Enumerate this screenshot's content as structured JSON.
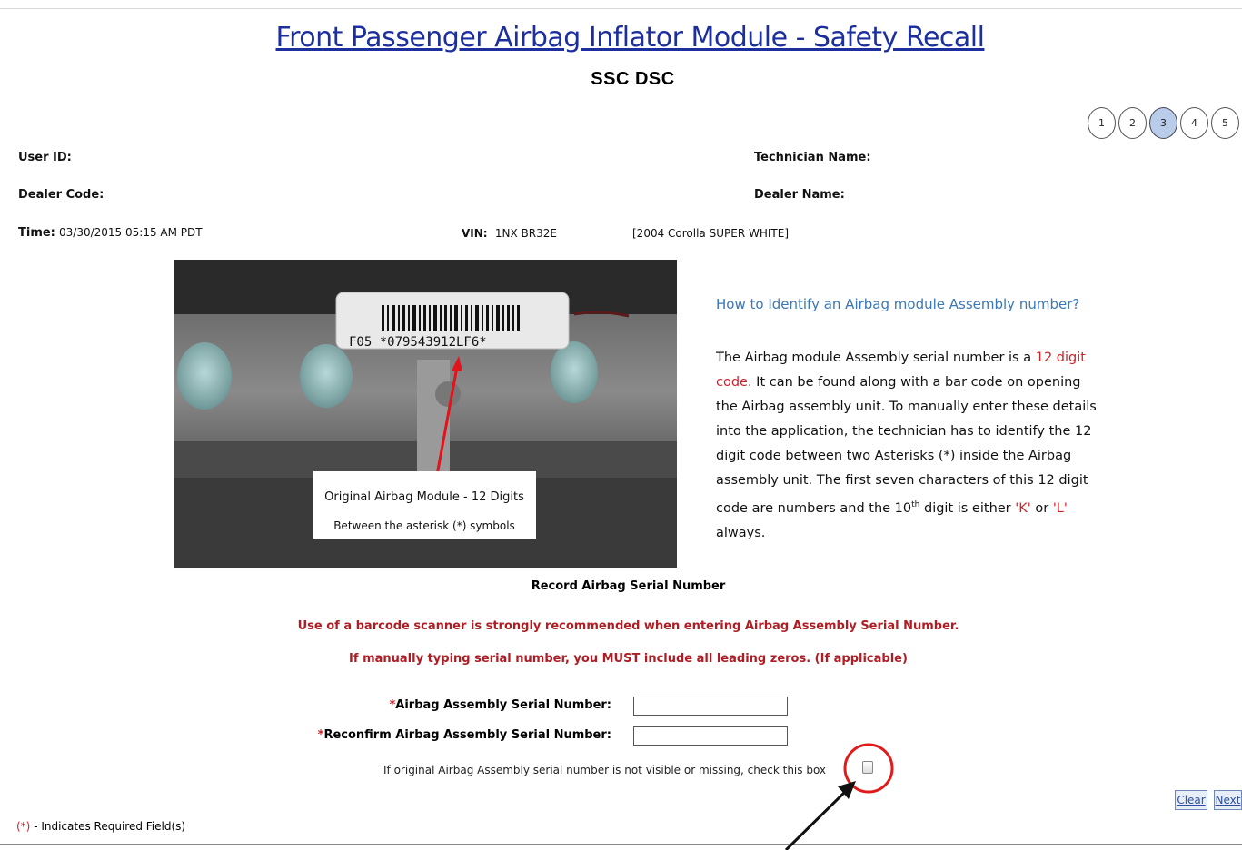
{
  "header": {
    "title": "Front Passenger Airbag Inflator Module - Safety Recall",
    "subtitle": "SSC DSC"
  },
  "steps": [
    "1",
    "2",
    "3",
    "4",
    "5"
  ],
  "active_step": "3",
  "fields": {
    "user_id_label": "User ID:",
    "technician_name_label": "Technician Name:",
    "dealer_code_label": "Dealer Code:",
    "dealer_name_label": "Dealer Name:",
    "time_label": "Time:",
    "time_value": "03/30/2015 05:15 AM PDT",
    "vin_label": "VIN:",
    "vin_value": "1NX BR32E",
    "vehicle_value": "[2004 Corolla SUPER WHITE]"
  },
  "photo": {
    "label_code": "F05 *079543912LF6*",
    "caption_line1": "Original Airbag Module - 12 Digits",
    "caption_line2": "Between the asterisk (*) symbols"
  },
  "info": {
    "title": "How to Identify an Airbag module Assembly number?",
    "p1": "The Airbag module Assembly serial number is a ",
    "p1_red": "12 digit code",
    "p2": ". It can be found along with a bar code on opening the Airbag assembly unit. To manually enter these details into the application, the technician has to identify the 12 digit code between two Asterisks (*) inside the Airbag assembly unit. The first seven characters of this 12 digit code are numbers and the 10",
    "sup": "th",
    "p3": " digit is either ",
    "k": "'K'",
    "or": " or ",
    "l": "'L'",
    "p4": " always."
  },
  "form": {
    "section_title": "Record Airbag Serial Number",
    "warning1": "Use of a barcode scanner is strongly recommended when entering Airbag Assembly Serial Number.",
    "warning2": "If manually typing serial number, you MUST include all leading zeros. (If applicable)",
    "required_star": "*",
    "serial_label": "Airbag Assembly Serial Number:",
    "reconfirm_label": "Reconfirm Airbag Assembly Serial Number:",
    "serial_value": "",
    "reconfirm_value": "",
    "missing_note": "If original Airbag Assembly serial number is not visible or missing, check this box",
    "missing_checked": false
  },
  "buttons": {
    "clear": "Clear",
    "next": "Next"
  },
  "footer": {
    "req_star": "(*)",
    "req_text": " - Indicates Required Field(s)"
  },
  "colors": {
    "title_blue": "#1c2f9c",
    "required_red": "#cc2229",
    "info_blue": "#3b78b7",
    "highlight_circle": "#e01b1b"
  }
}
